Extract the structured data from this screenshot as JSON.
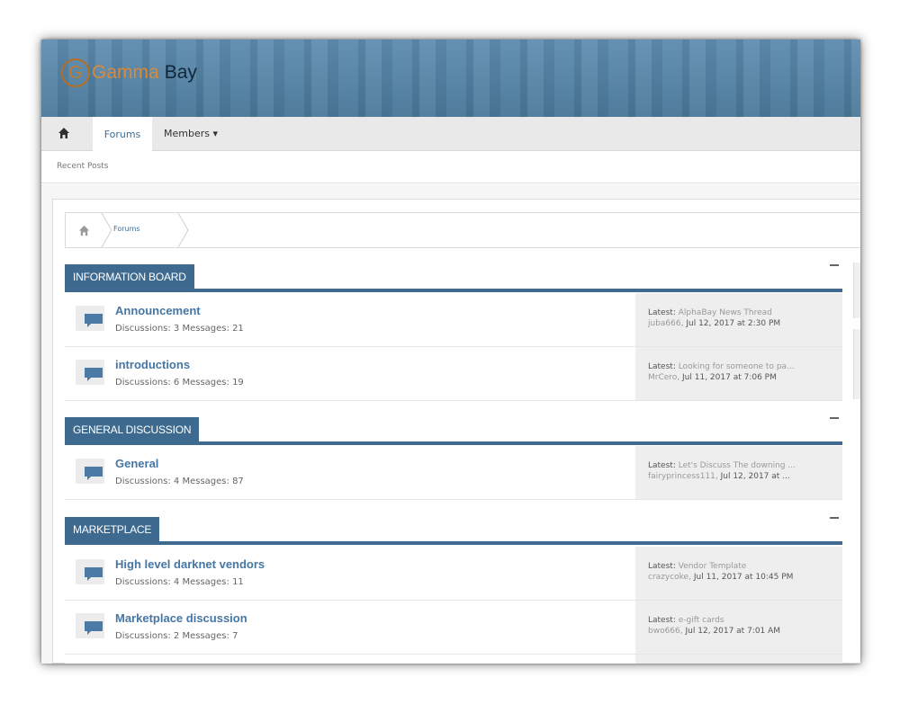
{
  "brand": {
    "letter": "G",
    "name_part1": "Gamma",
    "name_part2": "Bay"
  },
  "nav": {
    "home_icon": "home-icon",
    "tab_forums": "Forums",
    "tab_members": "Members ▾"
  },
  "subnav": {
    "recent_posts": "Recent Posts"
  },
  "breadcrumb": {
    "home_icon": "home-icon",
    "current": "Forums"
  },
  "colors": {
    "accent": "#3d6a8e",
    "link": "#4576a4",
    "banner": "#4f7d9f",
    "logo_orange": "#d8893a"
  },
  "categories": [
    {
      "title": "INFORMATION BOARD",
      "forums": [
        {
          "title": "Announcement",
          "stats": "Discussions: 3 Messages: 21",
          "latest_label": "Latest:",
          "latest_thread": "AlphaBay News Thread",
          "latest_user": "juba666,",
          "latest_date": "Jul 12, 2017 at 2:30 PM"
        },
        {
          "title": "introductions",
          "stats": "Discussions: 6 Messages: 19",
          "latest_label": "Latest:",
          "latest_thread": "Looking for someone to pa...",
          "latest_user": "MrCero,",
          "latest_date": "Jul 11, 2017 at 7:06 PM"
        }
      ]
    },
    {
      "title": "GENERAL DISCUSSION",
      "forums": [
        {
          "title": "General",
          "stats": "Discussions: 4 Messages: 87",
          "latest_label": "Latest:",
          "latest_thread": "Let's Discuss The downing ...",
          "latest_user": "fairyprincess111,",
          "latest_date": "Jul 12, 2017 at ..."
        }
      ]
    },
    {
      "title": "MARKETPLACE",
      "forums": [
        {
          "title": "High level darknet vendors",
          "stats": "Discussions: 4 Messages: 11",
          "latest_label": "Latest:",
          "latest_thread": "Vendor Template",
          "latest_user": "crazycoke,",
          "latest_date": "Jul 11, 2017 at 10:45 PM"
        },
        {
          "title": "Marketplace discussion",
          "stats": "Discussions: 2 Messages: 7",
          "latest_label": "Latest:",
          "latest_thread": "e-gift cards",
          "latest_user": "bwo666,",
          "latest_date": "Jul 12, 2017 at 7:01 AM"
        }
      ]
    }
  ]
}
